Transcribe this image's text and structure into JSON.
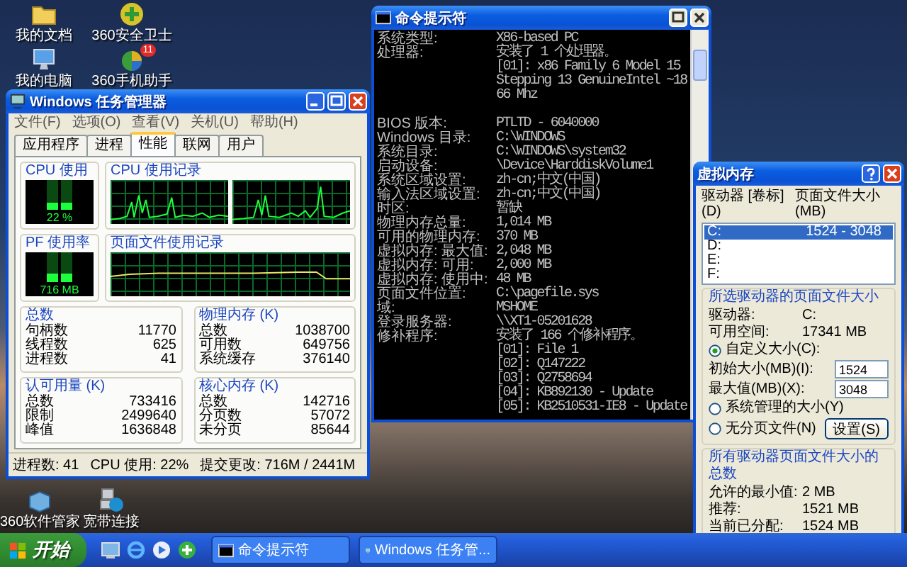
{
  "desktop_icons_top": [
    {
      "label": "我的文档",
      "kind": "folder"
    },
    {
      "label": "我的电脑",
      "kind": "computer"
    },
    {
      "label": "360安全卫士",
      "kind": "security"
    },
    {
      "label": "360手机助手",
      "kind": "phone",
      "badge": "11"
    }
  ],
  "desktop_icons_bottom": [
    {
      "label": "360软件管家",
      "kind": "software"
    },
    {
      "label": "宽带连接",
      "kind": "network"
    }
  ],
  "task_manager": {
    "title": "Windows 任务管理器",
    "menu": [
      "文件(F)",
      "选项(O)",
      "查看(V)",
      "关机(U)",
      "帮助(H)"
    ],
    "tabs": [
      {
        "label": "应用程序",
        "selected": false
      },
      {
        "label": "进程",
        "selected": false
      },
      {
        "label": "性能",
        "selected": true
      },
      {
        "label": "联网",
        "selected": false
      },
      {
        "label": "用户",
        "selected": false
      }
    ],
    "cpu_usage": {
      "label": "CPU 使用",
      "reading": "22 %",
      "level": 0.22
    },
    "cpu_history": {
      "label": "CPU 使用记录"
    },
    "pf_usage": {
      "label": "PF 使用率",
      "reading": "716 MB",
      "level": 0.29
    },
    "pf_history": {
      "label": "页面文件使用记录"
    },
    "groups": [
      {
        "title": "总数",
        "rows": [
          {
            "label": "句柄数",
            "value": "11770"
          },
          {
            "label": "线程数",
            "value": "625"
          },
          {
            "label": "进程数",
            "value": "41"
          }
        ]
      },
      {
        "title": "物理内存 (K)",
        "rows": [
          {
            "label": "总数",
            "value": "1038700"
          },
          {
            "label": "可用数",
            "value": "649756"
          },
          {
            "label": "系统缓存",
            "value": "376140"
          }
        ]
      },
      {
        "title": "认可用量 (K)",
        "rows": [
          {
            "label": "总数",
            "value": "733416"
          },
          {
            "label": "限制",
            "value": "2499640"
          },
          {
            "label": "峰值",
            "value": "1636848"
          }
        ]
      },
      {
        "title": "核心内存 (K)",
        "rows": [
          {
            "label": "总数",
            "value": "142716"
          },
          {
            "label": "分页数",
            "value": "57072"
          },
          {
            "label": "未分页",
            "value": "85644"
          }
        ]
      }
    ],
    "status_bar": [
      "进程数: 41",
      "CPU 使用: 22%",
      "提交更改: 716M / 2441M"
    ]
  },
  "command_prompt": {
    "title": "命令提示符",
    "lines": [
      {
        "kind": "field",
        "label": "系统类型:",
        "value": "X86-based PC"
      },
      {
        "kind": "field",
        "label": "处理器:",
        "value": "安装了 1 个处理器。"
      },
      {
        "kind": "sub",
        "value": "[01]: x86 Family 6 Model 15 Stepping 13 GenuineIntel ~1866 Mhz"
      },
      {
        "kind": "blank"
      },
      {
        "kind": "field",
        "label": "BIOS 版本:",
        "value": "PTLTD - 6040000"
      },
      {
        "kind": "field",
        "label": "Windows 目录:",
        "value": "C:\\WINDOWS"
      },
      {
        "kind": "field",
        "label": "系统目录:",
        "value": "C:\\WINDOWS\\system32"
      },
      {
        "kind": "field",
        "label": "启动设备:",
        "value": "\\Device\\HarddiskVolume1"
      },
      {
        "kind": "field",
        "label": "系统区域设置:",
        "value": "zh-cn;中文(中国)"
      },
      {
        "kind": "field",
        "label": "输入法区域设置:",
        "value": "zh-cn;中文(中国)"
      },
      {
        "kind": "field",
        "label": "时区:",
        "value": "暂缺"
      },
      {
        "kind": "field",
        "label": "物理内存总量:",
        "value": "1,014 MB"
      },
      {
        "kind": "field",
        "label": "可用的物理内存:",
        "value": "370 MB"
      },
      {
        "kind": "field",
        "label": "虚拟内存: 最大值:",
        "value": "2,048 MB"
      },
      {
        "kind": "field",
        "label": "虚拟内存: 可用:",
        "value": "2,000 MB"
      },
      {
        "kind": "field",
        "label": "虚拟内存: 使用中:",
        "value": "48 MB"
      },
      {
        "kind": "field",
        "label": "页面文件位置:",
        "value": "C:\\pagefile.sys"
      },
      {
        "kind": "field",
        "label": "域:",
        "value": "MSHOME"
      },
      {
        "kind": "field",
        "label": "登录服务器:",
        "value": "\\\\XT1-05201628"
      },
      {
        "kind": "field",
        "label": "修补程序:",
        "value": "安装了 166 个修补程序。"
      },
      {
        "kind": "sub",
        "value": "[01]: File 1"
      },
      {
        "kind": "sub",
        "value": "[02]: Q147222"
      },
      {
        "kind": "sub",
        "value": "[03]: Q2758694"
      },
      {
        "kind": "sub",
        "value": "[04]: KB892130 - Update"
      },
      {
        "kind": "sub",
        "value": "[05]: KB2510531-IE8 - Update"
      }
    ]
  },
  "virtual_memory": {
    "title": "虚拟内存",
    "list_headers": [
      "驱动器 [卷标](D)",
      "页面文件大小(MB)"
    ],
    "drives": [
      {
        "drive": "C:",
        "size": "1524 - 3048",
        "selected": true
      },
      {
        "drive": "D:",
        "selected": false
      },
      {
        "drive": "E:",
        "selected": false
      },
      {
        "drive": "F:",
        "selected": false
      }
    ],
    "selected_drive": {
      "title": "所选驱动器的页面文件大小",
      "info": [
        {
          "label": "驱动器:",
          "value": "C:"
        },
        {
          "label": "可用空间:",
          "value": "17341 MB"
        }
      ],
      "options": [
        {
          "label": "自定义大小(C):",
          "selected": true
        },
        {
          "label": "系统管理的大小(Y)",
          "selected": false
        },
        {
          "label": "无分页文件(N)",
          "selected": false
        }
      ],
      "fields": [
        {
          "label": "初始大小(MB)(I):",
          "value": "1524"
        },
        {
          "label": "最大值(MB)(X):",
          "value": "3048"
        }
      ],
      "set_button": "设置(S)"
    },
    "totals": {
      "title": "所有驱动器页面文件大小的总数",
      "rows": [
        {
          "label": "允许的最小值:",
          "value": "2 MB"
        },
        {
          "label": "推荐:",
          "value": "1521 MB"
        },
        {
          "label": "当前已分配:",
          "value": "1524 MB"
        }
      ]
    }
  },
  "taskbar": {
    "start": "开始",
    "buttons": [
      {
        "label": "命令提示符",
        "selected": false,
        "kind": "console"
      },
      {
        "label": "Windows 任务管...",
        "selected": false,
        "kind": "monitor"
      }
    ]
  }
}
